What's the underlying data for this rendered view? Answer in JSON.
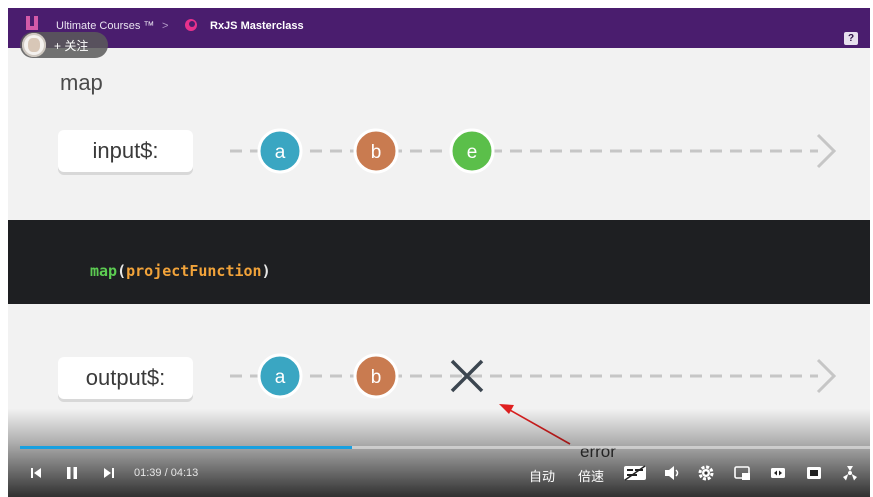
{
  "player": {
    "follow_label": "+ 关注",
    "time_current": "01:39",
    "time_separator": "/",
    "time_total": "04:13",
    "progress_fraction": 0.39,
    "auto_label": "自动",
    "speed_label": "倍速"
  },
  "course_bar": {
    "org": "Ultimate Courses ™",
    "separator": ">",
    "course": "RxJS Masterclass",
    "help": "?"
  },
  "slide": {
    "title": "map",
    "input_label": "input$:",
    "output_label": "output$:",
    "input_marbles": [
      {
        "label": "a",
        "color": "#3aa6c2"
      },
      {
        "label": "b",
        "color": "#c97b50"
      },
      {
        "label": "e",
        "color": "#5bbf4a"
      }
    ],
    "output_marbles": [
      {
        "label": "a",
        "color": "#3aa6c2"
      },
      {
        "label": "b",
        "color": "#c97b50"
      }
    ],
    "output_error_symbol": "X",
    "code": {
      "fn": "map",
      "open": "(",
      "arg": "projectFunction",
      "close": ")"
    }
  },
  "annotation": {
    "text": "error",
    "arrow_color": "#e02020"
  }
}
